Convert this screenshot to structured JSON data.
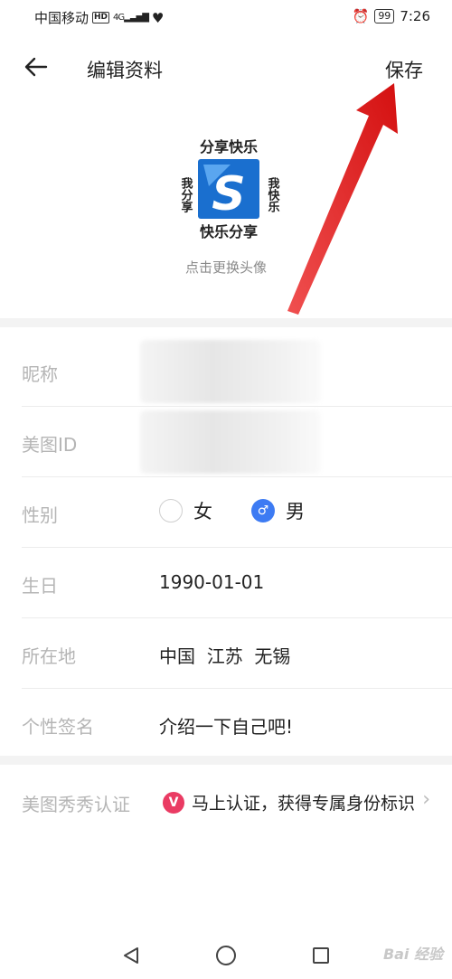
{
  "status_bar": {
    "carrier": "中国移动",
    "network": "HD",
    "signal": "4G",
    "battery": "99",
    "time": "7:26"
  },
  "header": {
    "title": "编辑资料",
    "save_label": "保存"
  },
  "avatar": {
    "top_text": "分享快乐",
    "left_text": "我分享",
    "right_text": "我快乐",
    "bottom_text": "快乐分享",
    "letter": "S",
    "hint": "点击更换头像"
  },
  "form": {
    "nickname_label": "昵称",
    "meitu_id_label": "美图ID",
    "gender_label": "性别",
    "gender_female": "女",
    "gender_male": "男",
    "birthday_label": "生日",
    "birthday_value": "1990-01-01",
    "location_label": "所在地",
    "location_value": "中国  江苏  无锡",
    "signature_label": "个性签名",
    "signature_value": "介绍一下自己吧!"
  },
  "certification": {
    "label": "美图秀秀认证",
    "badge": "V",
    "text": "马上认证，获得专属身份标识"
  },
  "watermark": "Bai 经验",
  "colors": {
    "accent": "#3d7bf3",
    "cert_badge": "#ea3b63",
    "arrow": "#e31b1b",
    "label_gray": "#b5b5b5"
  }
}
